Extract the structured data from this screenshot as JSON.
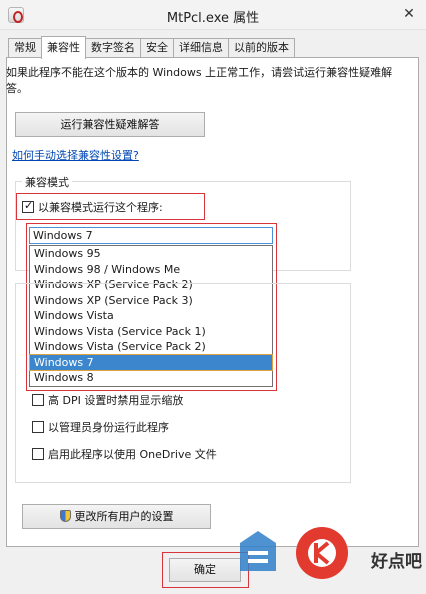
{
  "window": {
    "title": "MtPcl.exe 属性",
    "close_glyph": "✕"
  },
  "tabs": [
    {
      "label": "常规"
    },
    {
      "label": "兼容性",
      "active": true
    },
    {
      "label": "数字签名"
    },
    {
      "label": "安全"
    },
    {
      "label": "详细信息"
    },
    {
      "label": "以前的版本"
    }
  ],
  "compat": {
    "description": "如果此程序不能在这个版本的 Windows 上正常工作，请尝试运行兼容性疑难解答。",
    "troubleshoot_button": "运行兼容性疑难解答",
    "manual_link": "如何手动选择兼容性设置?",
    "mode_group_title": "兼容模式",
    "mode_checkbox_label": "以兼容模式运行这个程序:",
    "mode_checked": true,
    "selected_mode": "Windows 7",
    "mode_options": [
      "Windows 95",
      "Windows 98 / Windows Me",
      "Windows XP (Service Pack 2)",
      "Windows XP (Service Pack 3)",
      "Windows Vista",
      "Windows Vista (Service Pack 1)",
      "Windows Vista (Service Pack 2)",
      "Windows 7",
      "Windows 8"
    ],
    "settings": [
      {
        "label": "高 DPI 设置时禁用显示缩放",
        "checked": false
      },
      {
        "label": "以管理员身份运行此程序",
        "checked": false
      },
      {
        "label": "启用此程序以使用 OneDrive 文件",
        "checked": false
      }
    ],
    "all_users_button": "更改所有用户的设置"
  },
  "footer": {
    "ok_button": "确定"
  },
  "watermark": {
    "text": "好点吧"
  },
  "colors": {
    "highlight": "#d9343a",
    "link": "#0047b3",
    "selection": "#3b86cc"
  }
}
